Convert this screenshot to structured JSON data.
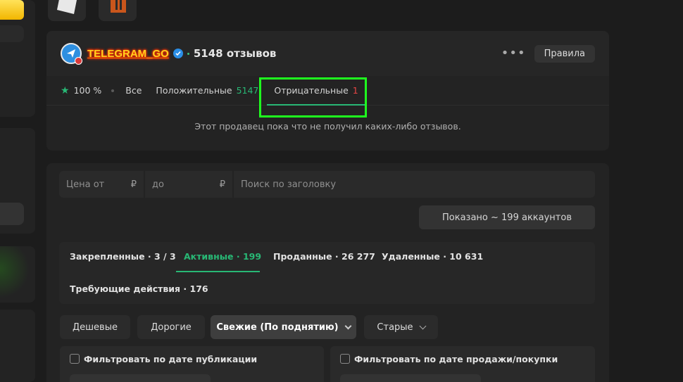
{
  "seller": {
    "name": "TELEGRAM_GO",
    "reviews_count": "5148 отзывов",
    "more_label": "•••",
    "rules_button": "Правила"
  },
  "review_tabs": {
    "rating": "100 %",
    "all": "Все",
    "positive_label": "Положительные",
    "positive_count": "5147",
    "negative_label": "Отрицательные",
    "negative_count": "1"
  },
  "empty_message": "Этот продавец пока что не получил каких-либо отзывов.",
  "filters": {
    "price_from_placeholder": "Цена от",
    "price_to_placeholder": "до",
    "currency": "₽",
    "search_placeholder": "Поиск по заголовку",
    "shown_label": "Показано ~ 199 аккаунтов"
  },
  "status_tabs": {
    "pinned": "Закрепленные · 3 / 3",
    "active": "Активные · 199",
    "sold": "Проданные · 26 277",
    "deleted": "Удаленные · 10 631",
    "needs_action": "Требующие действия · 176"
  },
  "sorting": {
    "cheap": "Дешевые",
    "expensive": "Дорогие",
    "fresh": "Свежие (По поднятию)",
    "old": "Старые"
  },
  "date_filters": {
    "publication": "Фильтровать по дате публикации",
    "sale": "Фильтровать по дате продажи/покупки"
  },
  "colors": {
    "accent": "#28b875",
    "negative": "#e84545",
    "highlight": "#1eff1e"
  }
}
